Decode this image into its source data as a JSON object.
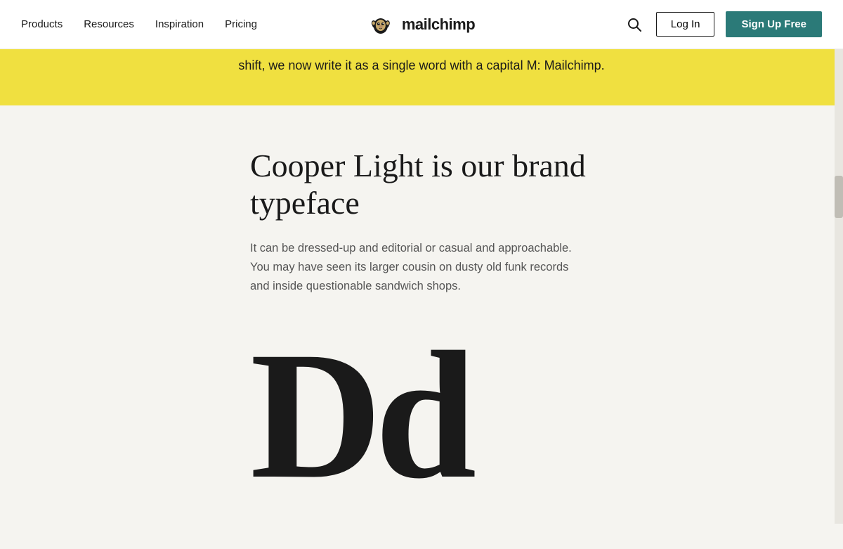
{
  "nav": {
    "logo_text": "mailchimp",
    "items": [
      {
        "label": "Products",
        "id": "products"
      },
      {
        "label": "Resources",
        "id": "resources"
      },
      {
        "label": "Inspiration",
        "id": "inspiration"
      },
      {
        "label": "Pricing",
        "id": "pricing"
      }
    ],
    "login_label": "Log In",
    "signup_label": "Sign Up Free"
  },
  "yellow_banner": {
    "text": "shift, we now write it as a single word with a capital M: Mailchimp."
  },
  "main": {
    "heading": "Cooper Light is our brand typeface",
    "body": "It can be dressed-up and editorial or casual and approachable. You may have seen its larger cousin on dusty old funk records and inside questionable sandwich shops.",
    "big_letter": "Dd"
  },
  "colors": {
    "yellow": "#f0e040",
    "teal": "#2b7a78",
    "bg": "#f5f4f0"
  }
}
